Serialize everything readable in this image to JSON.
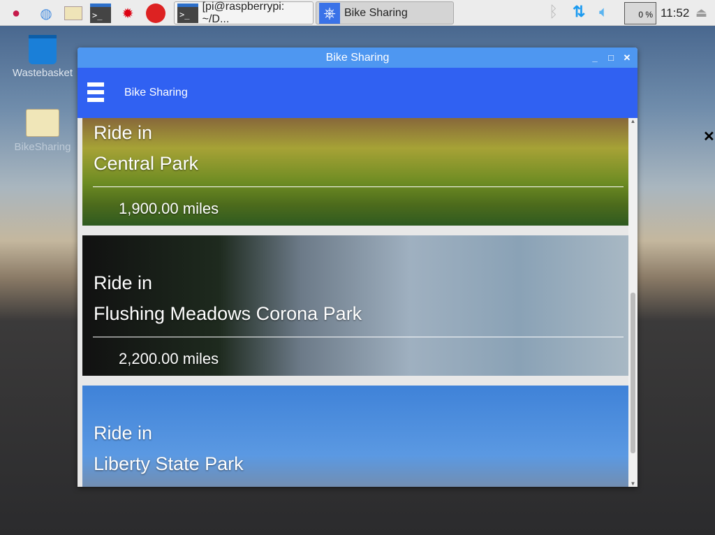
{
  "taskbar": {
    "launchers": [
      "raspberry-menu",
      "web-browser",
      "file-manager",
      "terminal",
      "mathematica",
      "wolfram"
    ],
    "tasks": [
      {
        "label": "[pi@raspberrypi: ~/D...",
        "icon": "terminal-icon"
      },
      {
        "label": "Bike Sharing",
        "icon": "bike-wheel-icon",
        "active": true
      }
    ],
    "cpu": "0 %",
    "clock": "11:52"
  },
  "desktop": {
    "icons": [
      {
        "label": "Wastebasket"
      },
      {
        "label": "BikeSharing"
      }
    ]
  },
  "window": {
    "title": "Bike Sharing",
    "app_title": "Bike Sharing",
    "cards": [
      {
        "prefix": "Ride in",
        "name": "Central Park",
        "miles": "1,900.00 miles"
      },
      {
        "prefix": "Ride in",
        "name": "Flushing Meadows Corona Park",
        "miles": "2,200.00 miles"
      },
      {
        "prefix": "Ride in",
        "name": "Liberty State Park",
        "miles": ""
      }
    ]
  },
  "colors": {
    "titlebar": "#4e97f1",
    "appbar": "#3061f2"
  }
}
